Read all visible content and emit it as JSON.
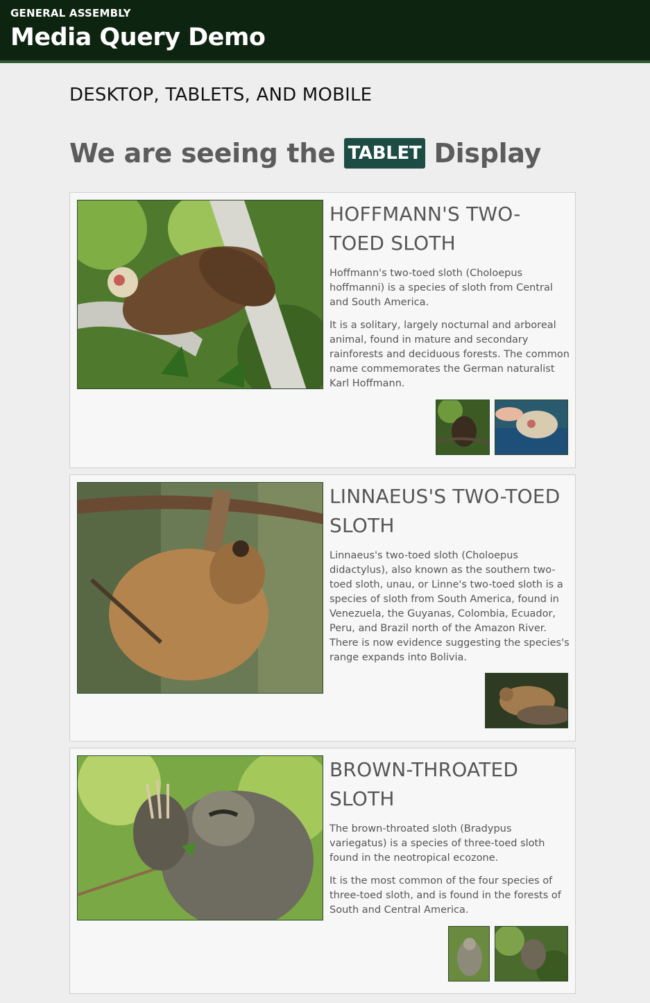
{
  "header": {
    "brand": "GENERAL ASSEMBLY",
    "title": "Media Query Demo"
  },
  "main": {
    "subtitle": "DESKTOP, TABLETS, AND MOBILE",
    "headline_before": "We are seeing the",
    "headline_badge": "TABLET",
    "headline_after": "Display"
  },
  "species": [
    {
      "title": "HOFFMANN'S TWO-TOED SLOTH",
      "paragraphs": [
        "Hoffmann's two-toed sloth (Choloepus hoffmanni) is a species of sloth from Central and South America.",
        "It is a solitary, largely nocturnal and arboreal animal, found in mature and secondary rainforests and deciduous forests. The common name commemorates the German naturalist Karl Hoffmann."
      ]
    },
    {
      "title": "LINNAEUS'S TWO-TOED SLOTH",
      "paragraphs": [
        "Linnaeus's two-toed sloth (Choloepus didactylus), also known as the southern two-toed sloth, unau, or Linne's two-toed sloth is a species of sloth from South America, found in Venezuela, the Guyanas, Colombia, Ecuador, Peru, and Brazil north of the Amazon River. There is now evidence suggesting the species's range expands into Bolivia."
      ]
    },
    {
      "title": "BROWN-THROATED SLOTH",
      "paragraphs": [
        "The brown-throated sloth (Bradypus variegatus) is a species of three-toed sloth found in the neotropical ecozone.",
        "It is the most common of the four species of three-toed sloth, and is found in the forests of South and Central America."
      ]
    }
  ],
  "colors": {
    "header_bg": "#0d2510",
    "header_border": "#2f5a34",
    "badge_bg": "#1d4c45",
    "page_bg": "#eeeeee",
    "card_bg": "#f7f7f7"
  }
}
